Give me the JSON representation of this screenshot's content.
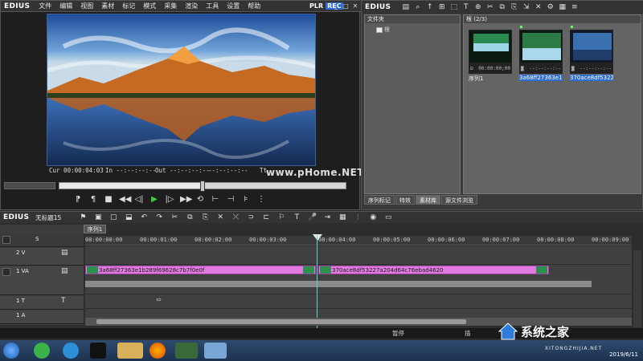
{
  "player": {
    "brand": "EDIUS",
    "menu": [
      "文件",
      "编辑",
      "视图",
      "素材",
      "标记",
      "模式",
      "采集",
      "渲染",
      "工具",
      "设置",
      "帮助"
    ],
    "plr": "PLR",
    "rec": "REC",
    "timecodes": {
      "cur": "Cur 00:00:04:03",
      "in": "In --:--:--:--",
      "out": "Out --:--:--:--",
      "ttl": "Tt"
    },
    "scrub_position": 0.5
  },
  "watermark": "www.pHome.NET",
  "bin": {
    "brand": "EDIUS",
    "folder_pane_title": "文件夹",
    "folder_root": "根",
    "clip_pane_title": "根 (2/3)",
    "clips": [
      {
        "label": "序列1",
        "timecode": "00:00:00;00",
        "selected": false
      },
      {
        "label": "3a68ff27363e1b...",
        "timecode": "--:--:--:--",
        "selected": true
      },
      {
        "label": "370ace8df53227...",
        "timecode": "--:--:--:--",
        "selected": true
      }
    ],
    "tabs": [
      "序列标记",
      "特效",
      "素材库",
      "源文件浏览"
    ],
    "active_tab": 2
  },
  "timeline": {
    "brand": "EDIUS",
    "project": "无标题15",
    "sequence_tab": "序列1",
    "ruler": [
      "00:00:00:00",
      "00:00:01:00",
      "00:00:02:00",
      "00:00:03:00",
      "00:00:04:00",
      "00:00:05:00",
      "00:00:06:00",
      "00:00:07:00",
      "00:00:08:00",
      "00:00:09:00"
    ],
    "tracks": [
      {
        "name": "2 V"
      },
      {
        "name": "1 VA"
      },
      {
        "name": "1 T"
      },
      {
        "name": "1 A"
      }
    ],
    "clip_a": "3a68ff27363e1b289f69628c7b7f0e0f",
    "clip_b": "370ace8df53227a204d64c76ebad4620",
    "header_mode": "S"
  },
  "status": {
    "paused": "暂停",
    "extra": "插"
  },
  "brand_watermark": {
    "text": "系统之家",
    "sub": "XITONGZHIJIA.NET"
  },
  "tray": {
    "time": "2019/6/11"
  },
  "colors": {
    "clip": "#e07ae0",
    "playhead": "#5cd6d6",
    "rec": "#2b6bd6"
  }
}
